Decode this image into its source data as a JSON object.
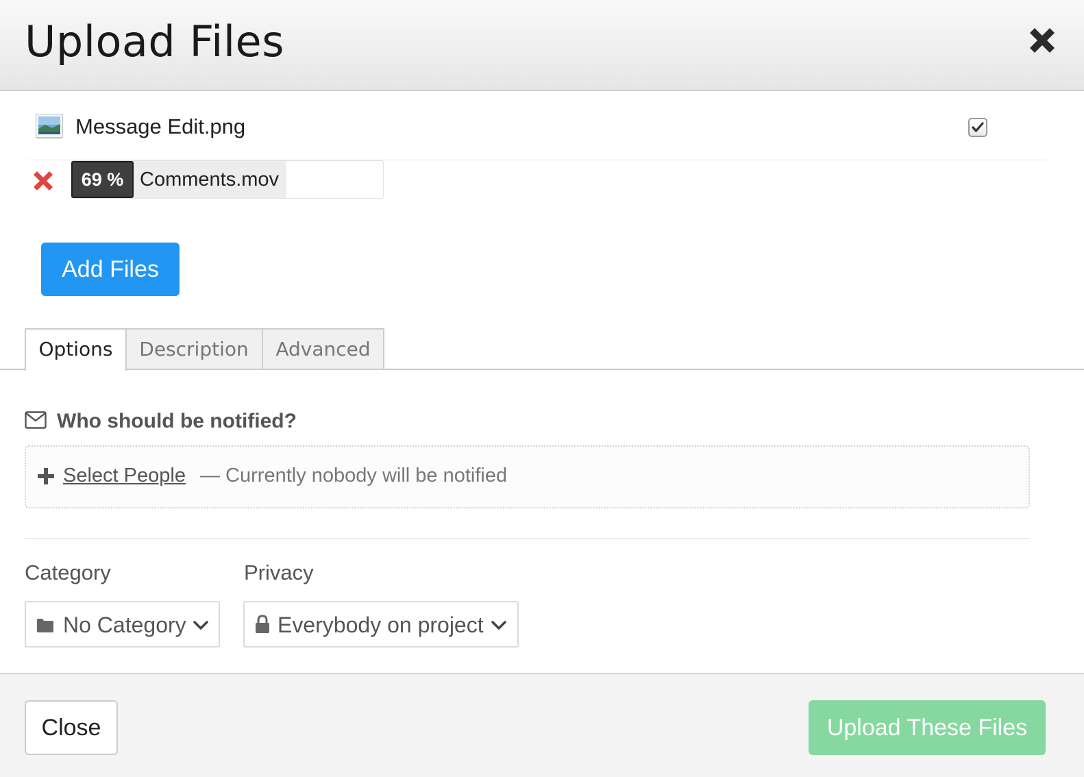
{
  "header": {
    "title": "Upload Files",
    "close_icon": "close-x-icon"
  },
  "files": [
    {
      "name": "Message Edit.png",
      "icon": "image-file-icon",
      "checked": true,
      "status": "complete"
    },
    {
      "name": "Comments.mov",
      "progress_label": "69 %",
      "progress": 0.69,
      "status": "uploading",
      "remove_icon": "remove-x-icon"
    }
  ],
  "add_files_label": "Add Files",
  "tabs": [
    {
      "label": "Options",
      "active": true
    },
    {
      "label": "Description",
      "active": false
    },
    {
      "label": "Advanced",
      "active": false
    }
  ],
  "notify": {
    "label": "Who should be notified?",
    "icon": "envelope-icon",
    "select_label": "Select People",
    "status_text": "— Currently nobody will be notified"
  },
  "category": {
    "label": "Category",
    "selected": "No Category",
    "icon": "folder-icon"
  },
  "privacy": {
    "label": "Privacy",
    "selected": "Everybody on project",
    "icon": "lock-icon"
  },
  "footer": {
    "close_label": "Close",
    "upload_label": "Upload These Files"
  },
  "colors": {
    "primary": "#2196f3",
    "success_disabled": "#86d8a0",
    "remove": "#e0453f",
    "progress_badge": "#3f3f3f"
  }
}
